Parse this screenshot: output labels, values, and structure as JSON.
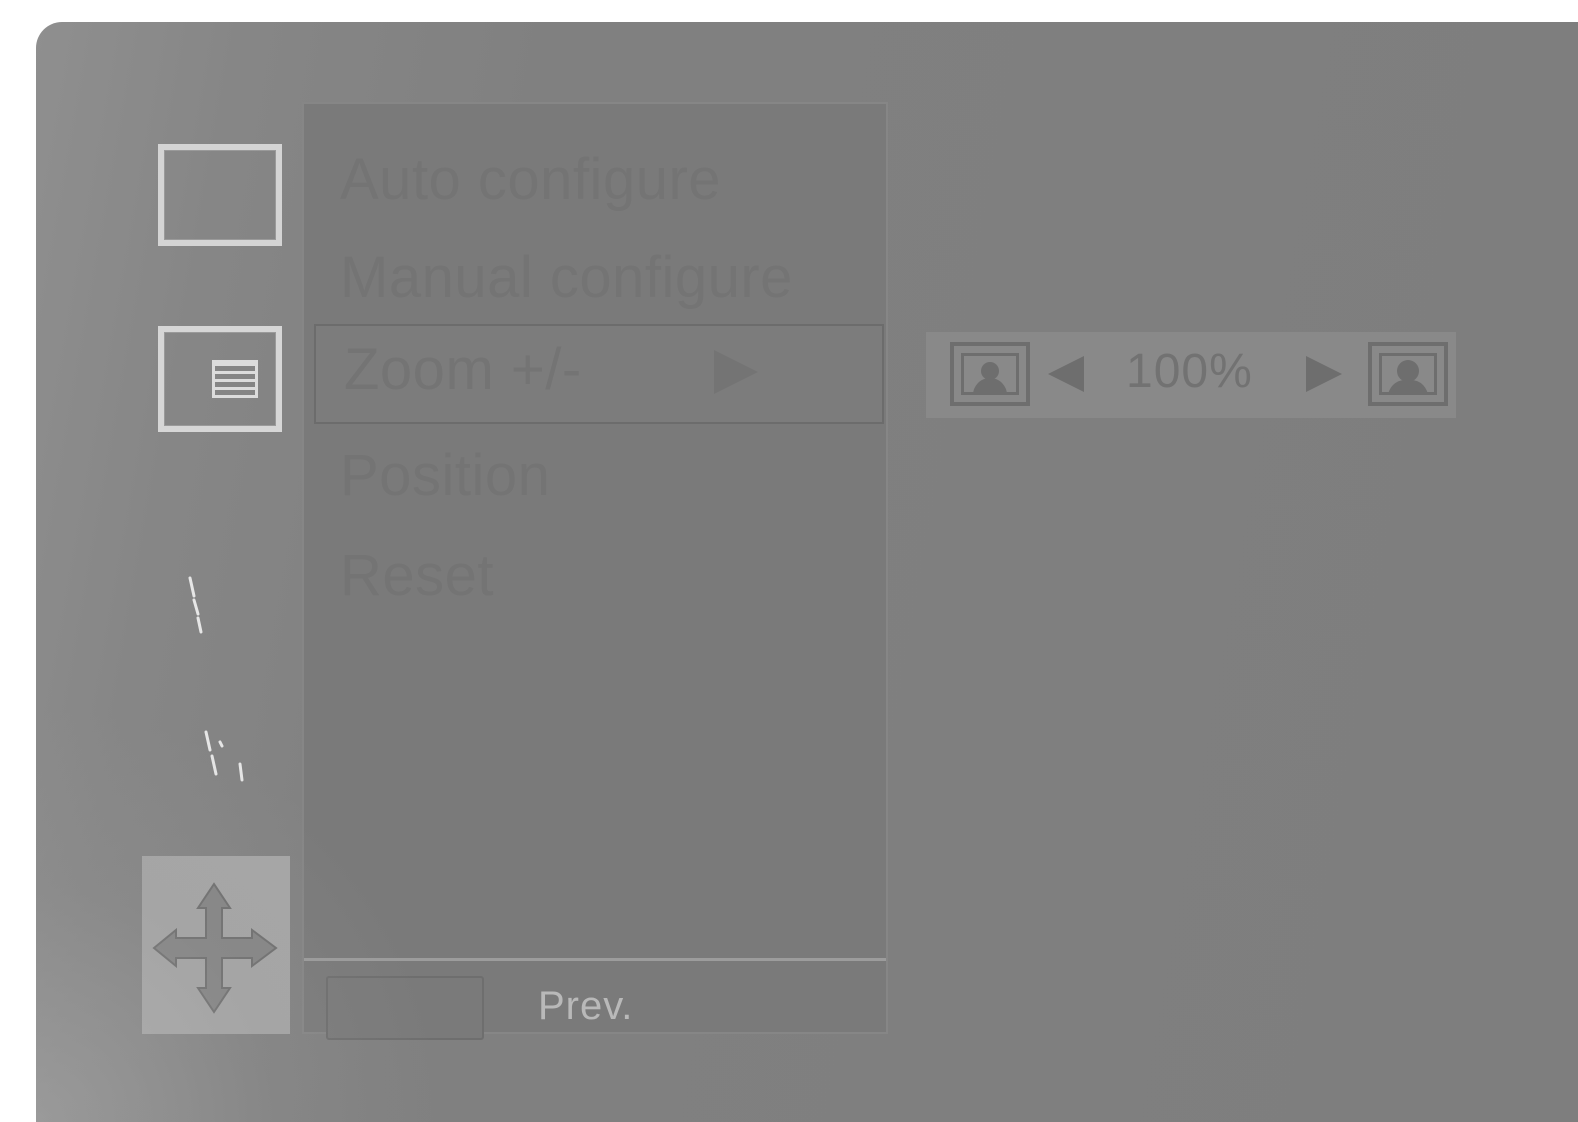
{
  "menu": {
    "items": [
      {
        "label": "Auto configure"
      },
      {
        "label": "Manual configure"
      },
      {
        "label": "Zoom +/-",
        "selected": true
      },
      {
        "label": "Position"
      },
      {
        "label": "Reset"
      }
    ],
    "footer": {
      "prev_label": "Prev."
    }
  },
  "sidebar": {
    "icons": [
      {
        "name": "picture-icon"
      },
      {
        "name": "picture-menu-icon"
      },
      {
        "name": "faint-icon"
      },
      {
        "name": "faint-icon"
      },
      {
        "name": "move-icon",
        "active": true
      }
    ]
  },
  "zoom": {
    "value": "100%"
  },
  "colors": {
    "background": "#808080",
    "panel": "#7a7a7a",
    "active_tile": "#a6a6a6",
    "text_dim": "#747474",
    "text_light": "#b9b9b9"
  }
}
